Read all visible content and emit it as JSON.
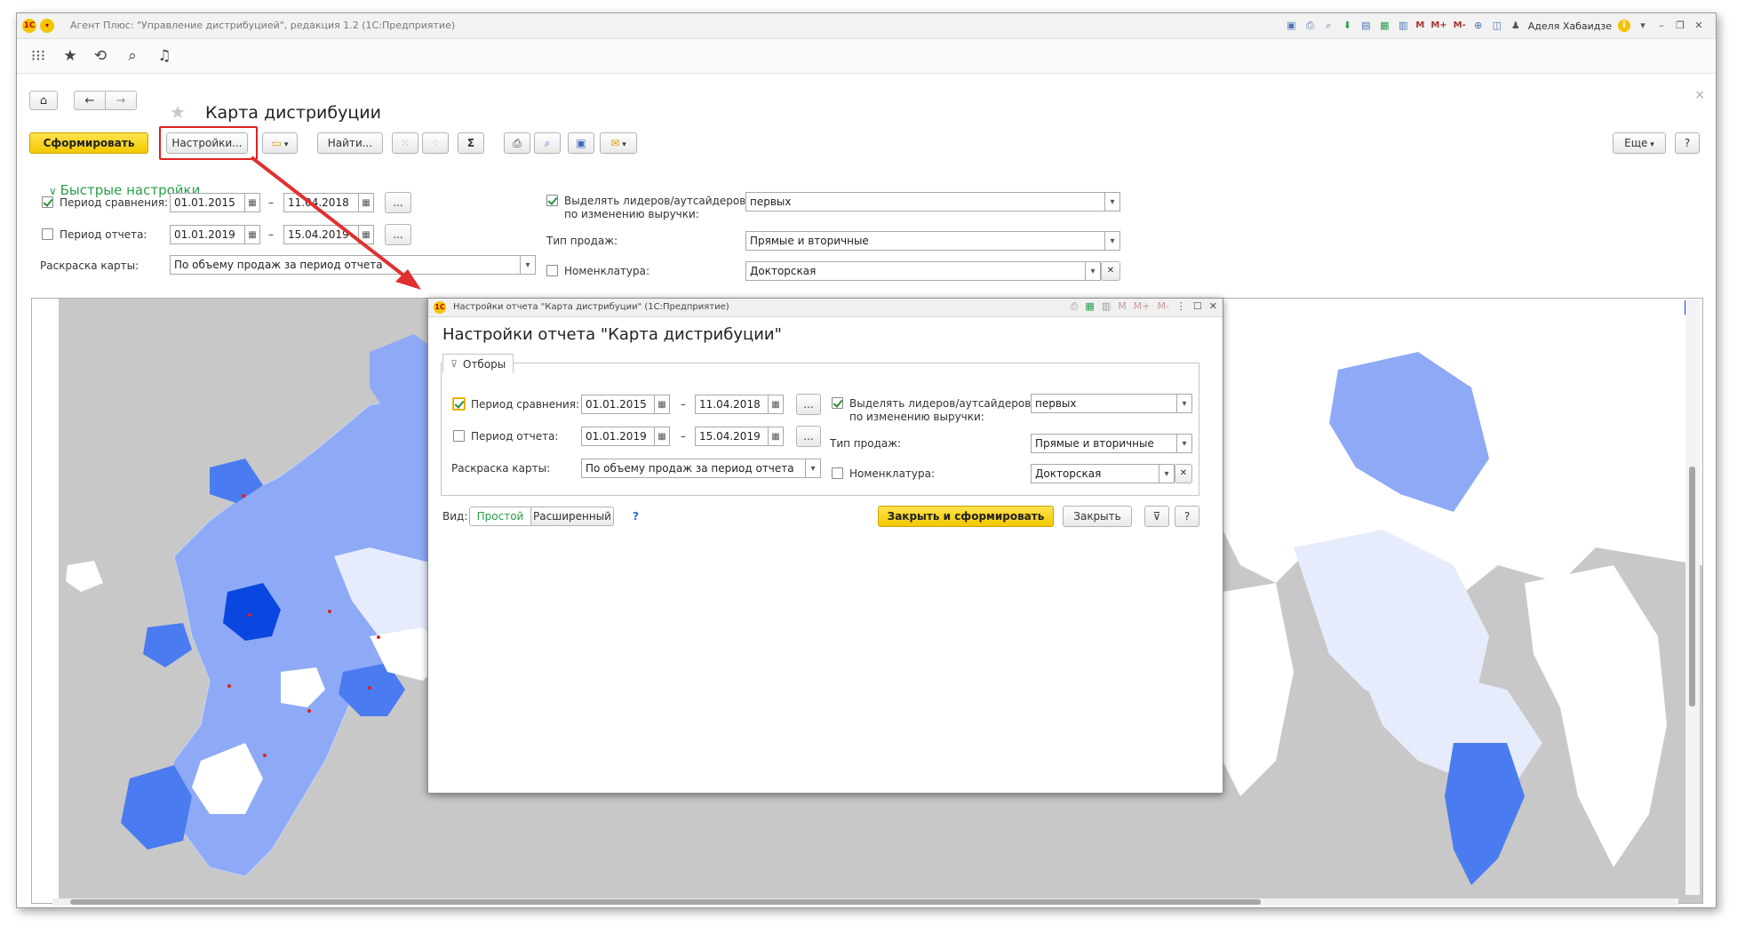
{
  "window": {
    "title": "Агент Плюс: \"Управление дистрибуцией\", редакция 1.2  (1С:Предприятие)",
    "logo": "1С",
    "user": "Аделя Хабаидзе",
    "toolbar_icons": [
      "save-icon",
      "print-icon",
      "preview-icon",
      "download-icon",
      "print2-icon",
      "calendar-icon",
      "calendar2-icon"
    ],
    "memory_buttons": [
      "M",
      "M+",
      "M-"
    ]
  },
  "nav": {
    "icons": [
      "apps-grid-icon",
      "favorites-star-icon",
      "history-icon",
      "search-icon",
      "notifications-bell-icon"
    ]
  },
  "page": {
    "title": "Карта дистрибуции",
    "close": "×"
  },
  "toolbar": {
    "generate": "Сформировать",
    "settings": "Настройки...",
    "find": "Найти...",
    "sigma": "Σ",
    "more": "Еще",
    "help": "?"
  },
  "quick_settings": {
    "title": "Быстрые настройки",
    "comparison_period": {
      "label": "Период сравнения:",
      "checked": true,
      "from": "01.01.2015",
      "dash": "–",
      "to": "11.04.2018",
      "more": "..."
    },
    "report_period": {
      "label": "Период отчета:",
      "checked": false,
      "from": "01.01.2019",
      "dash": "–",
      "to": "15.04.2019",
      "more": "..."
    },
    "map_coloring": {
      "label": "Раскраска карты:",
      "value": "По объему продаж за период отчета"
    },
    "highlight": {
      "label": "Выделять лидеров/аутсайдеров",
      "label2": "по изменению выручки:",
      "checked": true,
      "value": "первых"
    },
    "sales_type": {
      "label": "Тип продаж:",
      "value": "Прямые и вторичные"
    },
    "nomenclature": {
      "label": "Номенклатура:",
      "checked": false,
      "value": "Докторская"
    }
  },
  "dialog": {
    "window_title": "Настройки отчета \"Карта дистрибуции\"  (1С:Предприятие)",
    "title": "Настройки отчета \"Карта дистрибуции\"",
    "tab": "Отборы",
    "comparison_period": {
      "label": "Период сравнения:",
      "checked": true,
      "from": "01.01.2015",
      "dash": "–",
      "to": "11.04.2018",
      "more": "..."
    },
    "report_period": {
      "label": "Период отчета:",
      "checked": false,
      "from": "01.01.2019",
      "dash": "–",
      "to": "15.04.2019",
      "more": "..."
    },
    "map_coloring": {
      "label": "Раскраска карты:",
      "value": "По объему продаж за период отчета"
    },
    "highlight": {
      "label": "Выделять лидеров/аутсайдеров",
      "label2": "по изменению выручки:",
      "checked": true,
      "value": "первых"
    },
    "sales_type": {
      "label": "Тип продаж:",
      "value": "Прямые и вторичные"
    },
    "nomenclature": {
      "label": "Номенклатура:",
      "checked": false,
      "value": "Докторская"
    },
    "view_label": "Вид:",
    "view_simple": "Простой",
    "view_extended": "Расширенный",
    "view_help": "?",
    "close_and_generate": "Закрыть и сформировать",
    "close": "Закрыть",
    "help": "?"
  },
  "colors": {
    "accent_green": "#2a9d4a",
    "primary_yellow": "#f5c400",
    "highlight_red": "#e02020",
    "map_gray": "#c8c8c8",
    "region_light": "#e6ecfb",
    "region_mid": "#8eaaf6",
    "region_strong": "#4a7bf0",
    "region_dark": "#0a47e0"
  }
}
